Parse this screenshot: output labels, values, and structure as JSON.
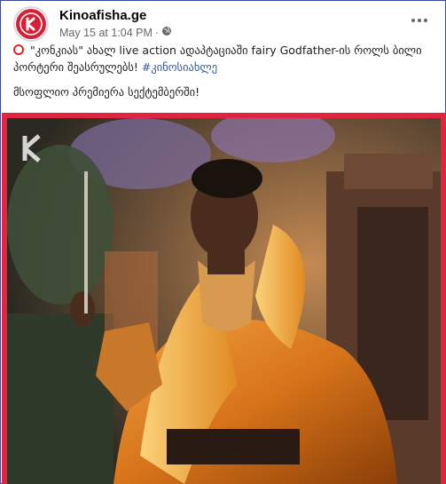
{
  "post": {
    "page_name": "Kinoafisha.ge",
    "timestamp": "May 15 at 1:04 PM",
    "separator": "·",
    "text_line1_quote_open": "\"კონკიას\" ახალ live action ადაპტაციაში fairy Godfather-ის როლს",
    "text_line2": "ბილი პორტერი შეასრულებს!",
    "hashtag": "#კინოსიახლე",
    "text_line3": "მსოფლიო პრემიერა სექტემბერში!"
  },
  "icons": {
    "logo": "kinoafisha-logo-icon",
    "privacy": "globe-icon",
    "more": "more-options-icon",
    "status": "red-circle-icon",
    "watermark": "kinoafisha-watermark-icon"
  },
  "colors": {
    "accent": "#d71f36",
    "frame": "#e4233f",
    "link": "#385898",
    "meta": "#65676b"
  }
}
